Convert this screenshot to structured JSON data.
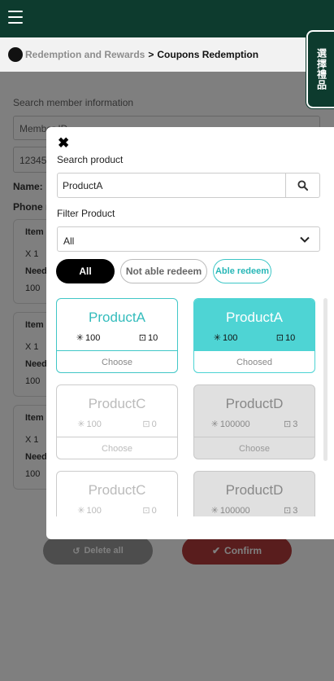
{
  "breadcrumb": {
    "parent": "Redemption and Rewards",
    "separator": ">",
    "current": "Coupons Redemption"
  },
  "gift_tab": {
    "label": "選擇禮品"
  },
  "member": {
    "search_label": "Search member information",
    "select_value": "Member ID",
    "input_value": "123456",
    "name_label": "Name:",
    "phone_label": "Phone n"
  },
  "items": [
    {
      "title": "Item",
      "qty": "X 1",
      "need_label": "Need",
      "value": "100"
    },
    {
      "title": "Item",
      "qty": "X 1",
      "need_label": "Need",
      "value": "100"
    },
    {
      "title": "Item",
      "qty": "X 1",
      "need_label": "Need",
      "value": "100"
    }
  ],
  "actions": {
    "delete_all": "Delete all",
    "confirm": "Confirm"
  },
  "modal": {
    "search_label": "Search product",
    "search_value": "ProductA",
    "filter_label": "Filter Product",
    "filter_value": "All",
    "filters": [
      "All",
      "Not able redeem",
      "Able redeem"
    ],
    "products": [
      {
        "name": "ProductA",
        "points": "100",
        "stock": "10",
        "action": "Choose"
      },
      {
        "name": "ProductA",
        "points": "100",
        "stock": "10",
        "action": "Choosed"
      },
      {
        "name": "ProductC",
        "points": "100",
        "stock": "0",
        "action": "Choose"
      },
      {
        "name": "ProductD",
        "points": "100000",
        "stock": "3",
        "action": "Choose"
      },
      {
        "name": "ProductC",
        "points": "100",
        "stock": "0",
        "action": ""
      },
      {
        "name": "ProductD",
        "points": "100000",
        "stock": "3",
        "action": ""
      }
    ]
  },
  "icons": {
    "menu": "hamburger-icon",
    "close": "close-icon",
    "search": "search-icon",
    "chevron": "chevron-down-icon",
    "points": "asterisk-icon",
    "stock": "coupon-icon",
    "undo": "undo-icon",
    "check": "check-icon"
  },
  "colors": {
    "header": "#0d3b2e",
    "accent_teal": "#4ed4d4",
    "confirm": "#b33a3a"
  }
}
